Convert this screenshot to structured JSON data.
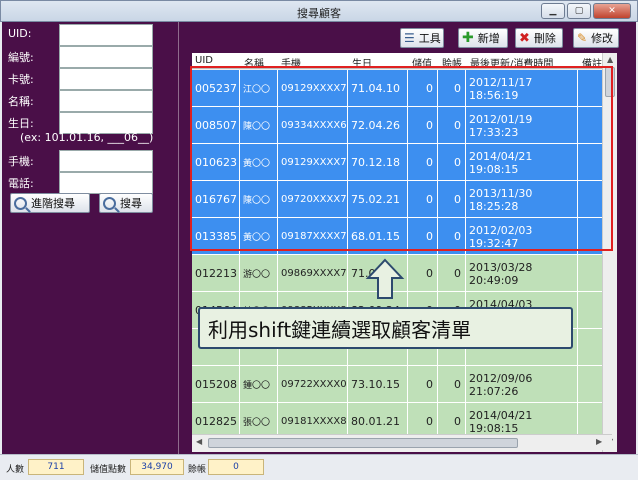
{
  "window": {
    "title": "搜尋顧客"
  },
  "form": {
    "uid_label": "UID:",
    "number_label": "編號:",
    "card_label": "卡號:",
    "name_label": "名稱:",
    "birthday_label": "生日:",
    "birthday_hint": "(ex: 101.01.16, ___06__)",
    "phone_label": "手機:",
    "tel_label": "電話:",
    "advanced_search": "進階搜尋",
    "search": "搜尋"
  },
  "toolbar": {
    "tools": "工具",
    "add": "新增",
    "delete": "刪除",
    "edit": "修改"
  },
  "table": {
    "columns": [
      "UID",
      "名稱",
      "手機",
      "生日",
      "儲值",
      "賒帳",
      "最後更新/消費時間",
      "備註"
    ],
    "rows": [
      {
        "uid": "005237",
        "name": "江〇〇",
        "mobile": "09129XXXX7",
        "birthday": "71.04.10",
        "stored": "0",
        "credit": "0",
        "updated": "2012/11/17 18:56:19",
        "selected": true
      },
      {
        "uid": "008507",
        "name": "陳〇〇",
        "mobile": "09334XXXX6",
        "birthday": "72.04.26",
        "stored": "0",
        "credit": "0",
        "updated": "2012/01/19 17:33:23",
        "selected": true
      },
      {
        "uid": "010623",
        "name": "黃〇〇",
        "mobile": "09129XXXX7",
        "birthday": "70.12.18",
        "stored": "0",
        "credit": "0",
        "updated": "2014/04/21 19:08:15",
        "selected": true
      },
      {
        "uid": "016767",
        "name": "陳〇〇",
        "mobile": "09720XXXX7",
        "birthday": "75.02.21",
        "stored": "0",
        "credit": "0",
        "updated": "2013/11/30 18:25:28",
        "selected": true
      },
      {
        "uid": "013385",
        "name": "黃〇〇",
        "mobile": "09187XXXX7",
        "birthday": "68.01.15",
        "stored": "0",
        "credit": "0",
        "updated": "2012/02/03 19:32:47",
        "selected": true
      },
      {
        "uid": "012213",
        "name": "游〇〇",
        "mobile": "09869XXXX7",
        "birthday": "71.0",
        "stored": "0",
        "credit": "0",
        "updated": "2013/03/28 20:49:09",
        "selected": false
      },
      {
        "uid": "014564",
        "name": "林〇〇",
        "mobile": "09885XXXX8",
        "birthday": "82.09.24",
        "stored": "0",
        "credit": "0",
        "updated": "2014/04/03 18:54:12",
        "selected": false
      },
      {
        "uid": "",
        "name": "",
        "mobile": "",
        "birthday": "",
        "stored": "",
        "credit": "",
        "updated": "",
        "selected": false
      },
      {
        "uid": "015208",
        "name": "鍾〇〇",
        "mobile": "09722XXXX0",
        "birthday": "73.10.15",
        "stored": "0",
        "credit": "0",
        "updated": "2012/09/06 21:07:26",
        "selected": false
      },
      {
        "uid": "012825",
        "name": "張〇〇",
        "mobile": "09181XXXX8",
        "birthday": "80.01.21",
        "stored": "0",
        "credit": "0",
        "updated": "2014/04/21 19:08:15",
        "selected": false
      }
    ]
  },
  "callout": {
    "text": "利用shift鍵連續選取顧客清單"
  },
  "status": {
    "count_label": "人數",
    "count_value": "711",
    "stored_label": "儲值點數",
    "stored_value": "34,970",
    "credit_label": "賒帳",
    "credit_value": "0"
  }
}
